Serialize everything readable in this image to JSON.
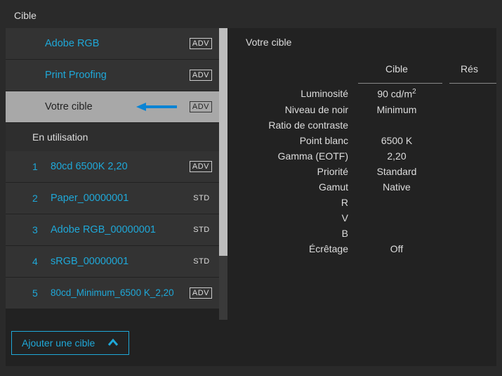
{
  "title": "Cible",
  "badges": {
    "adv": "ADV",
    "std": "STD"
  },
  "presets": [
    {
      "label": "Adobe RGB",
      "mode": "adv"
    },
    {
      "label": "Print Proofing",
      "mode": "adv"
    },
    {
      "label": "Votre cible",
      "mode": "adv",
      "selected": true,
      "arrow": true
    }
  ],
  "in_use_header": "En utilisation",
  "in_use": [
    {
      "num": "1",
      "label": "80cd 6500K 2,20",
      "mode": "adv"
    },
    {
      "num": "2",
      "label": "Paper_00000001",
      "mode": "std"
    },
    {
      "num": "3",
      "label": "Adobe RGB_00000001",
      "mode": "std"
    },
    {
      "num": "4",
      "label": "sRGB_00000001",
      "mode": "std"
    },
    {
      "num": "5",
      "label": "80cd_Minimum_6500 K_2,20",
      "mode": "adv",
      "multiline": true
    }
  ],
  "add_button": "Ajouter une cible",
  "detail": {
    "title": "Votre cible",
    "col_cible": "Cible",
    "col_res": "Rés",
    "rows": {
      "luminosite": {
        "k": "Luminosité",
        "v": "90 cd/m",
        "sup": "2"
      },
      "noir": {
        "k": "Niveau de noir",
        "v": "Minimum"
      },
      "contraste": {
        "k": "Ratio de contraste",
        "v": ""
      },
      "blanc": {
        "k": "Point blanc",
        "v": "6500 K"
      },
      "gamma": {
        "k": "Gamma (EOTF)",
        "v": "2,20"
      },
      "priorite": {
        "k": "Priorité",
        "v": "Standard"
      },
      "gamut": {
        "k": "Gamut",
        "v": "Native"
      },
      "r": {
        "k": "R",
        "v": ""
      },
      "v2": {
        "k": "V",
        "v": ""
      },
      "b": {
        "k": "B",
        "v": ""
      },
      "ecretage": {
        "k": "Écrêtage",
        "v": "Off"
      }
    }
  }
}
